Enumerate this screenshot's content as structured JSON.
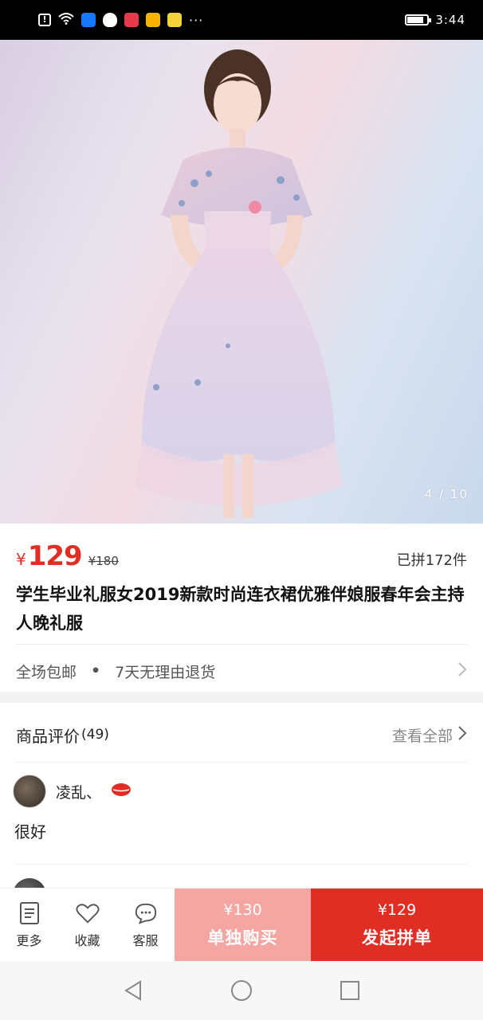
{
  "status_bar": {
    "time": "3:44",
    "icons": [
      "alert-icon",
      "wifi-icon",
      "shield-app-icon",
      "penguin-icon",
      "app-icon",
      "weibo-icon",
      "fruit-app-icon",
      "more-dots-icon"
    ],
    "dots": "···"
  },
  "hero": {
    "image_description_icon": "product-photo-dress",
    "counter": "4 / 10"
  },
  "price": {
    "currency": "¥",
    "current": "129",
    "original": "¥180",
    "sold": "已拼172件",
    "accent_color": "#e02e24"
  },
  "product": {
    "title": "学生毕业礼服女2019新款时尚连衣裙优雅伴娘服春年会主持人晚礼服"
  },
  "services": {
    "free_shipping": "全场包邮",
    "separator": "•",
    "returns": "7天无理由退货"
  },
  "reviews": {
    "title": "商品评价",
    "count": "(49)",
    "view_all": "查看全部",
    "items": [
      {
        "user": "凌乱、",
        "text": "很好"
      }
    ]
  },
  "bottom_bar": {
    "more": "更多",
    "favorite": "收藏",
    "service": "客服",
    "solo_price": "¥130",
    "solo_label": "单独购买",
    "group_price": "¥129",
    "group_label": "发起拼单",
    "solo_color": "#f4a6a2",
    "group_color": "#e02e24"
  }
}
